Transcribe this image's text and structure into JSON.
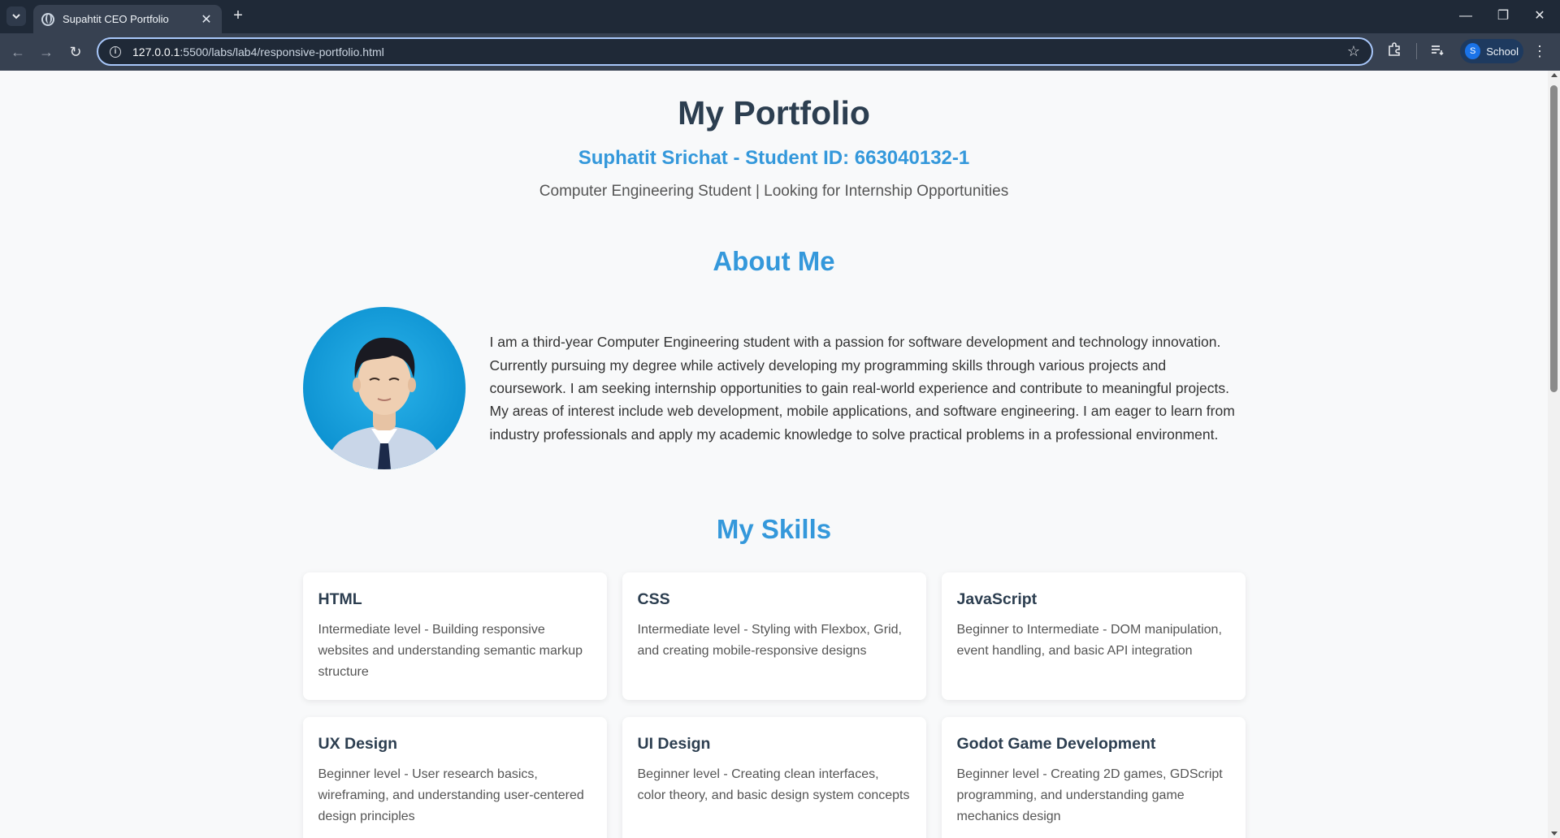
{
  "browser": {
    "tab_title": "Supahtit CEO Portfolio",
    "url_host": "127.0.0.1",
    "url_path": ":5500/labs/lab4/responsive-portfolio.html",
    "profile_initial": "S",
    "profile_label": "School"
  },
  "header": {
    "title": "My Portfolio",
    "subtitle": "Suphatit Srichat - Student ID: 663040132-1",
    "tagline": "Computer Engineering Student | Looking for Internship Opportunities"
  },
  "about": {
    "title": "About Me",
    "text": "I am a third-year Computer Engineering student with a passion for software development and technology innovation. Currently pursuing my degree while actively developing my programming skills through various projects and coursework. I am seeking internship opportunities to gain real-world experience and contribute to meaningful projects. My areas of interest include web development, mobile applications, and software engineering. I am eager to learn from industry professionals and apply my academic knowledge to solve practical problems in a professional environment."
  },
  "skills": {
    "title": "My Skills",
    "items": [
      {
        "name": "HTML",
        "desc": "Intermediate level - Building responsive websites and understanding semantic markup structure"
      },
      {
        "name": "CSS",
        "desc": "Intermediate level - Styling with Flexbox, Grid, and creating mobile-responsive designs"
      },
      {
        "name": "JavaScript",
        "desc": "Beginner to Intermediate - DOM manipulation, event handling, and basic API integration"
      },
      {
        "name": "UX Design",
        "desc": "Beginner level - User research basics, wireframing, and understanding user-centered design principles"
      },
      {
        "name": "UI Design",
        "desc": "Beginner level - Creating clean interfaces, color theory, and basic design system concepts"
      },
      {
        "name": "Godot Game Development",
        "desc": "Beginner level - Creating 2D games, GDScript programming, and understanding game mechanics design"
      }
    ]
  },
  "colors": {
    "accent": "#3498db",
    "heading": "#2c3e50",
    "page_bg": "#f8f9fa"
  }
}
